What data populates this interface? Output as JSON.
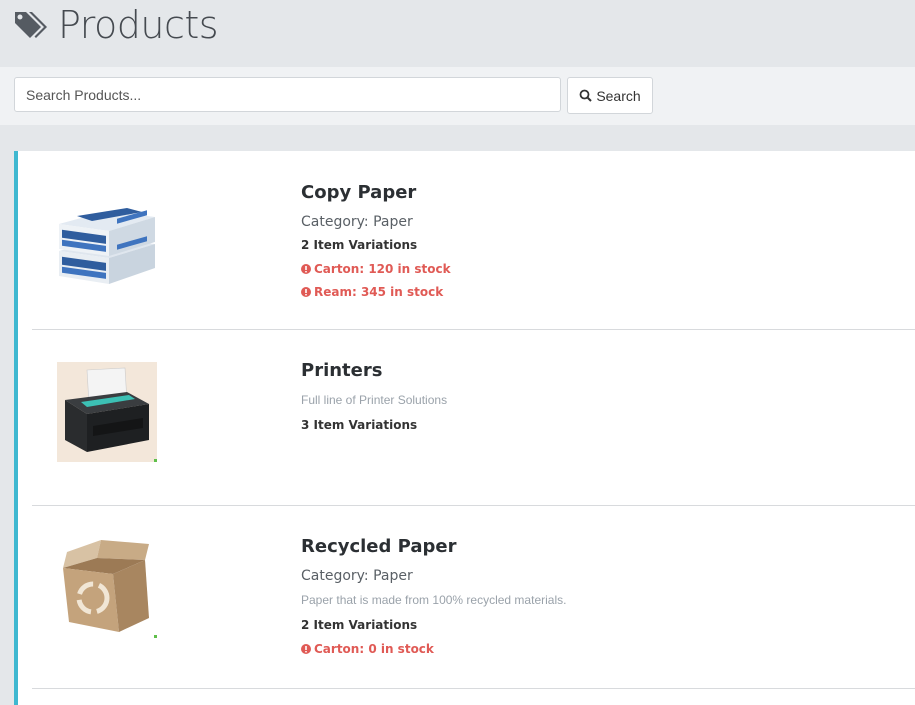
{
  "header": {
    "title": "Products",
    "icon": "tags-icon"
  },
  "search": {
    "placeholder": "Search Products...",
    "value": "",
    "button_label": "Search",
    "button_icon": "search-icon"
  },
  "colors": {
    "accent": "#3fb8d0",
    "warning": "#e05a55"
  },
  "products": [
    {
      "name": "Copy Paper",
      "category": "Category: Paper",
      "variations": "2 Item Variations",
      "stock": [
        "Carton: 120 in stock",
        "Ream: 345 in stock"
      ],
      "image": "copy-paper-box-image"
    },
    {
      "name": "Printers",
      "description": "Full line of Printer Solutions",
      "variations": "3 Item Variations",
      "image": "printer-image"
    },
    {
      "name": "Recycled Paper",
      "category": "Category: Paper",
      "description": "Paper that is made from 100% recycled materials.",
      "variations": "2 Item Variations",
      "stock": [
        "Carton: 0 in stock"
      ],
      "image": "recycled-box-image"
    }
  ]
}
